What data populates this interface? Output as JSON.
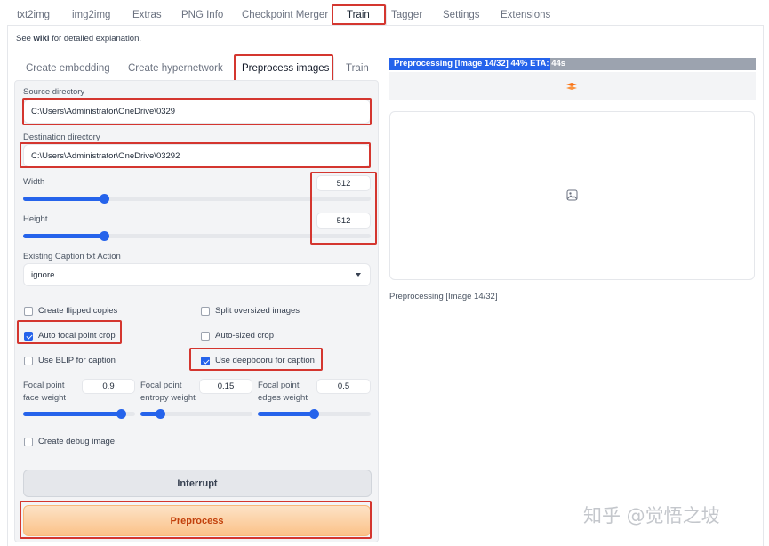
{
  "top_tabs": [
    "txt2img",
    "img2img",
    "Extras",
    "PNG Info",
    "Checkpoint Merger",
    "Train",
    "Tagger",
    "Settings",
    "Extensions"
  ],
  "active_top_tab": "Train",
  "notice": {
    "prefix": "See ",
    "link": "wiki",
    "suffix": " for detailed explanation."
  },
  "sub_tabs": [
    "Create embedding",
    "Create hypernetwork",
    "Preprocess images",
    "Train"
  ],
  "active_sub_tab": "Preprocess images",
  "source_directory": {
    "label": "Source directory",
    "value": "C:\\Users\\Administrator\\OneDrive\\0329"
  },
  "destination_directory": {
    "label": "Destination directory",
    "value": "C:\\Users\\Administrator\\OneDrive\\03292"
  },
  "width": {
    "label": "Width",
    "value": "512",
    "fraction": 0.197
  },
  "height": {
    "label": "Height",
    "value": "512",
    "fraction": 0.197
  },
  "caption_action": {
    "label": "Existing Caption txt Action",
    "value": "ignore"
  },
  "checkboxes": {
    "create_flipped": {
      "label": "Create flipped copies",
      "checked": false
    },
    "split_oversized": {
      "label": "Split oversized images",
      "checked": false
    },
    "auto_focal": {
      "label": "Auto focal point crop",
      "checked": true
    },
    "auto_sized": {
      "label": "Auto-sized crop",
      "checked": false
    },
    "use_blip": {
      "label": "Use BLIP for caption",
      "checked": false
    },
    "use_deepbooru": {
      "label": "Use deepbooru for caption",
      "checked": true
    },
    "debug_image": {
      "label": "Create debug image",
      "checked": false
    }
  },
  "focal": {
    "face": {
      "label_line1": "Focal point",
      "label_line2": "face weight",
      "value": "0.9",
      "fraction": 0.9
    },
    "entropy": {
      "label_line1": "Focal point",
      "label_line2": "entropy weight",
      "value": "0.15",
      "fraction": 0.15
    },
    "edges": {
      "label_line1": "Focal point",
      "label_line2": "edges weight",
      "value": "0.5",
      "fraction": 0.5
    }
  },
  "buttons": {
    "interrupt": "Interrupt",
    "preprocess": "Preprocess"
  },
  "progress": {
    "text": "Preprocessing [Image 14/32] 44% ETA: 44s",
    "percent": 44
  },
  "status_text": "Preprocessing [Image 14/32]",
  "watermark": "知乎 @觉悟之坡",
  "colors": {
    "accent": "#2563eb",
    "highlight": "#d4362f",
    "preprocess_bg": "#fbcf9f",
    "preprocess_text": "#c2410c"
  }
}
